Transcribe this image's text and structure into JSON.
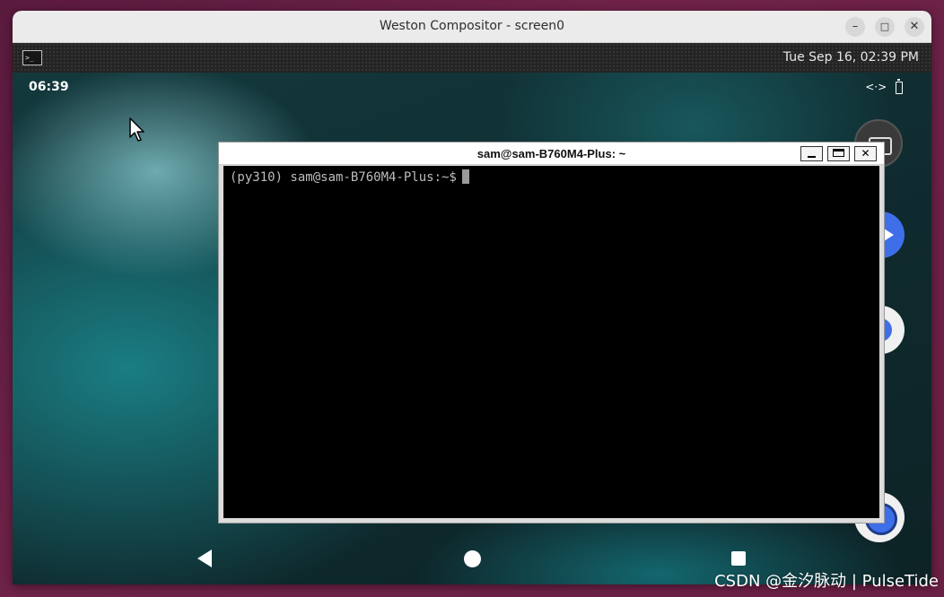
{
  "host_window": {
    "title": "Weston Compositor - screen0",
    "minimize_glyph": "–",
    "maximize_glyph": "□",
    "close_glyph": "✕"
  },
  "weston_panel": {
    "launcher_icon": "terminal-icon",
    "launcher_glyph": ">_",
    "clock": "Tue Sep 16, 02:39 PM"
  },
  "android": {
    "status_time": "06:39",
    "status_icons": [
      "data-transfer-icon",
      "battery-icon"
    ],
    "data_glyph": "<·>",
    "side_apps": [
      "camera-app-icon",
      "send-app-icon",
      "messages-app-icon",
      "messages-app-icon-2"
    ],
    "nav": [
      "back-icon",
      "home-icon",
      "recents-icon"
    ]
  },
  "terminal": {
    "title": "sam@sam-B760M4-Plus: ~",
    "prompt": "(py310) sam@sam-B760M4-Plus:~$",
    "close_glyph": "✕"
  },
  "watermark": "CSDN @金汐脉动 | PulseTide",
  "colors": {
    "terminal_bg": "#000000",
    "prompt_text": "#bdbdbd",
    "android_accent": "#3f6fe8",
    "desktop_bg": "#6e2248"
  }
}
